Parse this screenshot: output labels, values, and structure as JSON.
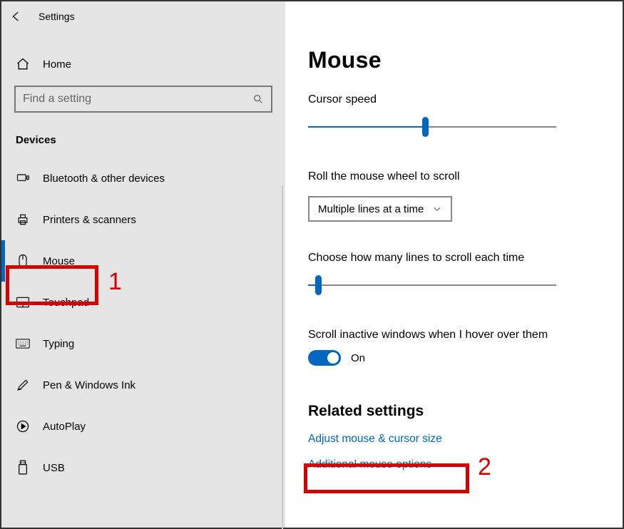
{
  "header": {
    "app_title": "Settings"
  },
  "sidebar": {
    "home_label": "Home",
    "search_placeholder": "Find a setting",
    "section_title": "Devices",
    "items": [
      {
        "label": "Bluetooth & other devices"
      },
      {
        "label": "Printers & scanners"
      },
      {
        "label": "Mouse"
      },
      {
        "label": "Touchpad"
      },
      {
        "label": "Typing"
      },
      {
        "label": "Pen & Windows Ink"
      },
      {
        "label": "AutoPlay"
      },
      {
        "label": "USB"
      }
    ]
  },
  "main": {
    "title": "Mouse",
    "cursor_speed_label": "Cursor speed",
    "cursor_speed_percent": 47,
    "scroll_mode_label": "Roll the mouse wheel to scroll",
    "scroll_mode_value": "Multiple lines at a time",
    "lines_label": "Choose how many lines to scroll each time",
    "lines_percent": 4,
    "hover_label": "Scroll inactive windows when I hover over them",
    "hover_state": "On",
    "related_title": "Related settings",
    "link1": "Adjust mouse & cursor size",
    "link2": "Additional mouse options"
  },
  "annotations": {
    "one": "1",
    "two": "2"
  }
}
